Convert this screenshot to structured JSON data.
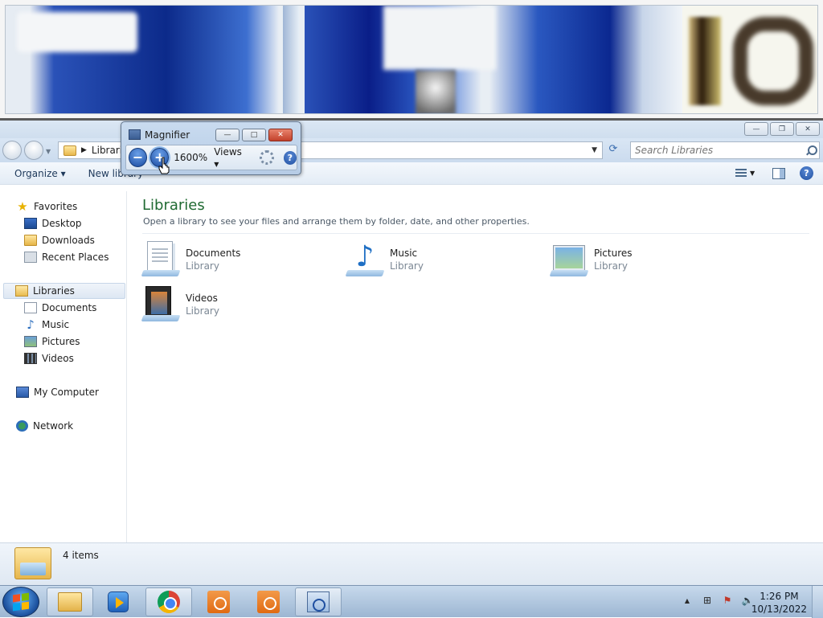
{
  "magnifier": {
    "title": "Magnifier",
    "zoom_out": "−",
    "zoom_in": "+",
    "zoom_level": "1600%",
    "views_label": "Views",
    "minimize": "—",
    "restore": "□",
    "close": "✕",
    "help": "?"
  },
  "explorer": {
    "window_controls": {
      "minimize": "—",
      "restore": "❐",
      "close": "✕"
    },
    "breadcrumb": "Libraries",
    "search_placeholder": "Search Libraries",
    "toolbar": {
      "organize": "Organize ▾",
      "new_library": "New library"
    },
    "help": "?",
    "nav": {
      "favorites": "Favorites",
      "desktop": "Desktop",
      "downloads": "Downloads",
      "recent_places": "Recent Places",
      "libraries": "Libraries",
      "documents": "Documents",
      "music": "Music",
      "pictures": "Pictures",
      "videos": "Videos",
      "my_computer": "My Computer",
      "network": "Network"
    },
    "main": {
      "title": "Libraries",
      "subtitle": "Open a library to see your files and arrange them by folder, date, and other properties.",
      "items": [
        {
          "name": "Documents",
          "kind": "Library",
          "icon": "documents-library-icon"
        },
        {
          "name": "Music",
          "kind": "Library",
          "icon": "music-library-icon"
        },
        {
          "name": "Pictures",
          "kind": "Library",
          "icon": "pictures-library-icon"
        },
        {
          "name": "Videos",
          "kind": "Library",
          "icon": "videos-library-icon"
        }
      ]
    },
    "status": {
      "count": "4 items"
    }
  },
  "taskbar": {
    "clock_time": "1:26 PM",
    "clock_date": "10/13/2022",
    "tray_up_arrow": "▲",
    "tray_network": "⊞",
    "tray_flag": "⚑",
    "tray_volume": "🔈"
  },
  "colors": {
    "libraries_heading": "#1f6a32",
    "accent_blue": "#1f4fa0",
    "close_red": "#c3412b"
  }
}
